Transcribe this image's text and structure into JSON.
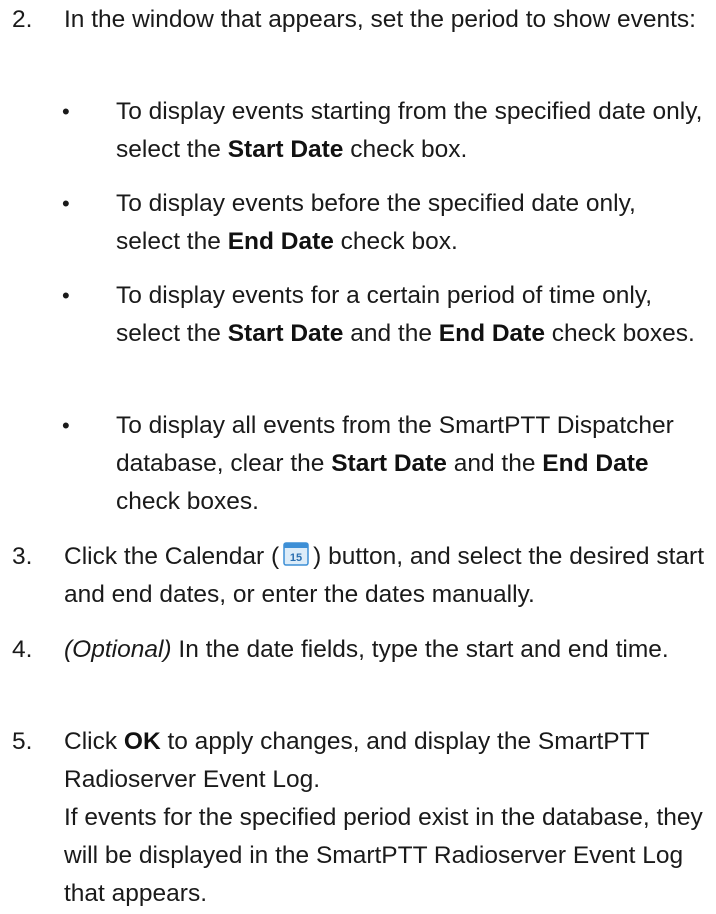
{
  "steps": [
    {
      "number": "2.",
      "text": "In the window that appears, set the period to show events:"
    },
    {
      "number": "3.",
      "pre": "Click the Calendar (",
      "icon": "calendar-icon",
      "post": ") button, and select the desired start and end dates, or enter the dates manually."
    },
    {
      "number": "4.",
      "italic": "(Optional)",
      "text": " In the date fields, type the start and end time."
    },
    {
      "number": "5.",
      "pre": "Click ",
      "bold": "OK",
      "post": " to apply changes, and display the SmartPTT Radioserver Event Log.",
      "note": "If events for the specified period exist in the database, they will be displayed in the SmartPTT Radioserver Event Log that appears."
    }
  ],
  "bullets": [
    {
      "dot": "•",
      "pre": "To display events starting from the specified date only, select the ",
      "bold1": "Start Date",
      "post": " check box."
    },
    {
      "dot": "•",
      "pre": "To display events before the specified date only, select the ",
      "bold1": "End Date",
      "post": " check box."
    },
    {
      "dot": "•",
      "pre": "To display events for a certain period of time only, select the ",
      "bold1": "Start Date",
      "mid": " and the ",
      "bold2": "End Date",
      "post": " check boxes."
    },
    {
      "dot": "•",
      "pre": "To display all events from the SmartPTT Dispatcher database, clear the ",
      "bold1": "Start Date",
      "mid": " and the ",
      "bold2": "End Date",
      "post": " check boxes."
    }
  ],
  "icon_label": "15",
  "colors": {
    "icon_blue": "#3d8fd6",
    "icon_fill": "#dcecf9"
  }
}
